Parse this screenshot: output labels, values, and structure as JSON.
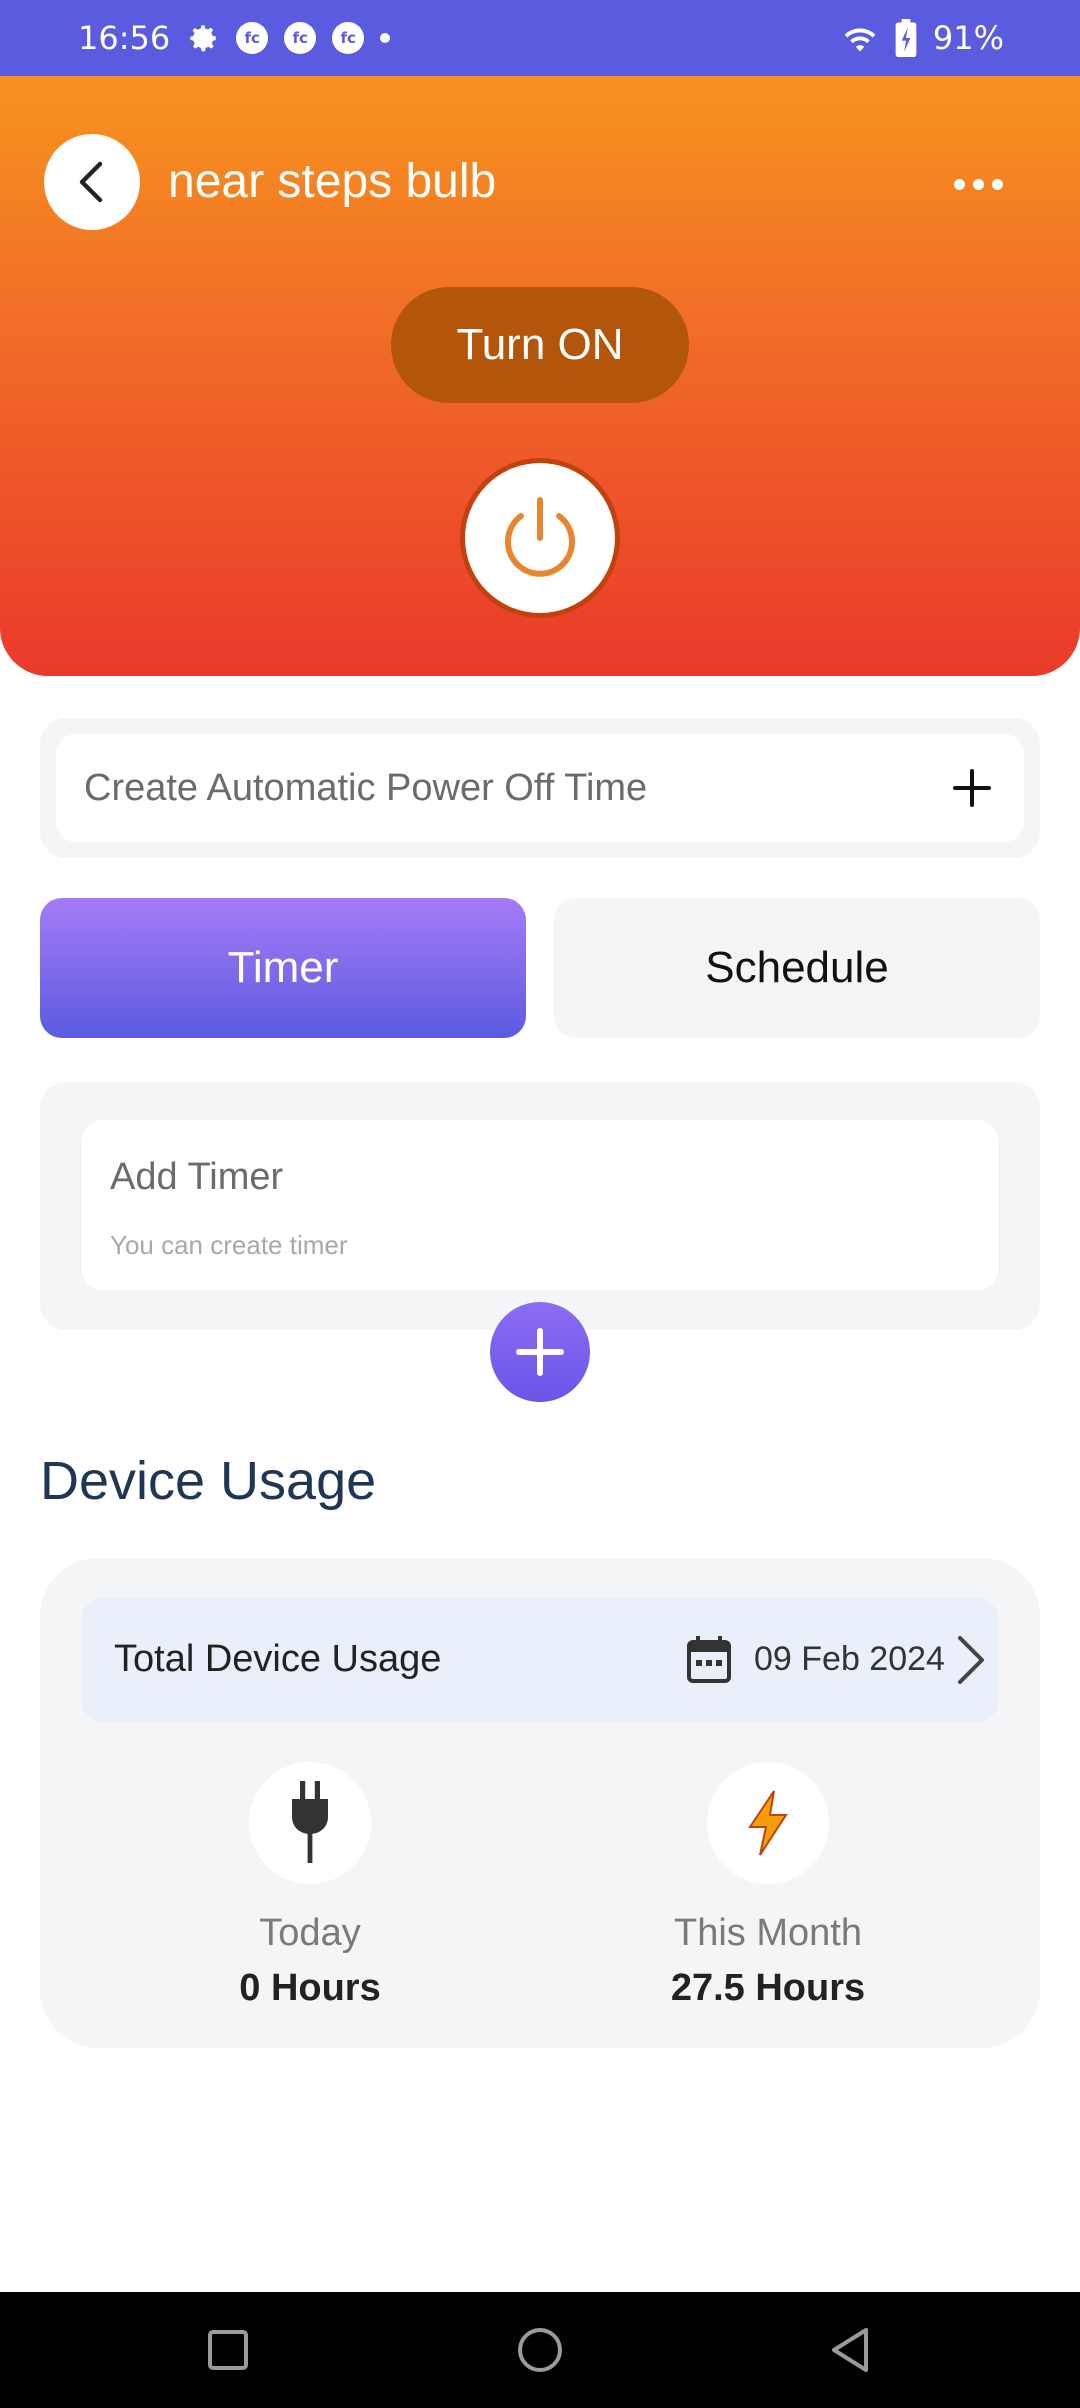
{
  "status_bar": {
    "time": "16:56",
    "battery": "91%",
    "icons": [
      "settings-icon",
      "fc-notification-icon",
      "fc-notification-icon",
      "fc-notification-icon",
      "dot-icon",
      "wifi-icon",
      "battery-charging-icon"
    ],
    "fc_text": "fc"
  },
  "header": {
    "device_name": "near steps bulb",
    "turn_on_label": "Turn ON",
    "gradient_colors": [
      "#f7931e",
      "#ea3a2a"
    ]
  },
  "auto_power_off": {
    "label": "Create Automatic Power Off Time"
  },
  "tabs": [
    {
      "label": "Timer",
      "active": true
    },
    {
      "label": "Schedule",
      "active": false
    }
  ],
  "timer": {
    "title": "Add Timer",
    "subtitle": "You can create timer"
  },
  "device_usage": {
    "section_title": "Device Usage",
    "card_title": "Total Device Usage",
    "date": "09 Feb 2024",
    "stats": {
      "today": {
        "label": "Today",
        "value": "0 Hours",
        "icon": "plug-icon"
      },
      "month": {
        "label": "This Month",
        "value": "27.5 Hours",
        "icon": "lightning-icon"
      }
    }
  },
  "colors": {
    "status_bar": "#5b5bdf",
    "accent_purple": "#5b5bdf",
    "turn_on_button": "#b3550a",
    "title_navy": "#1f3656",
    "lightning": "#f59e0b"
  }
}
